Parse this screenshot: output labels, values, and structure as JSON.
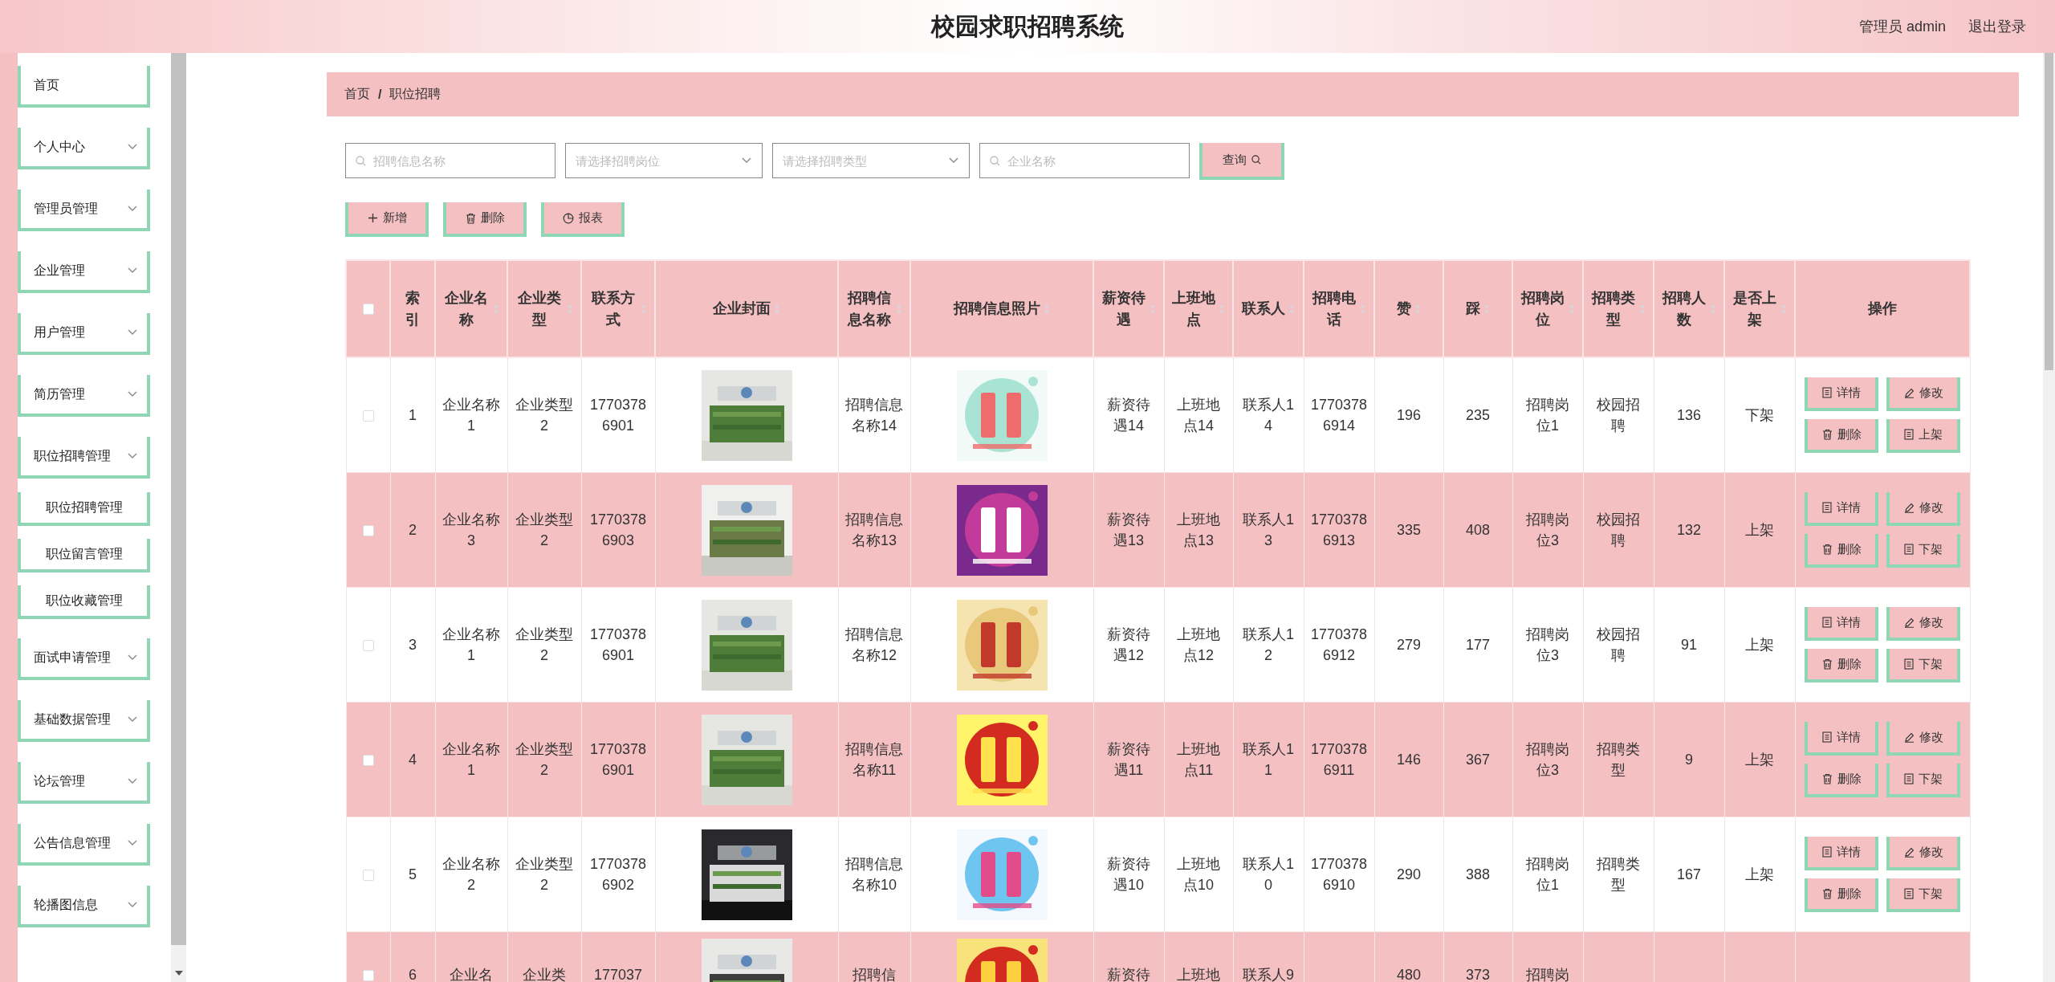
{
  "header": {
    "title": "校园求职招聘系统",
    "user": "管理员 admin",
    "logout": "退出登录"
  },
  "sidebar": {
    "items": [
      {
        "label": "首页",
        "kind": "link"
      },
      {
        "label": "个人中心",
        "kind": "menu"
      },
      {
        "label": "管理员管理",
        "kind": "menu"
      },
      {
        "label": "企业管理",
        "kind": "menu"
      },
      {
        "label": "用户管理",
        "kind": "menu"
      },
      {
        "label": "简历管理",
        "kind": "menu"
      },
      {
        "label": "职位招聘管理",
        "kind": "menu",
        "children": [
          {
            "label": "职位招聘管理"
          },
          {
            "label": "职位留言管理"
          },
          {
            "label": "职位收藏管理"
          }
        ]
      },
      {
        "label": "面试申请管理",
        "kind": "menu"
      },
      {
        "label": "基础数据管理",
        "kind": "menu"
      },
      {
        "label": "论坛管理",
        "kind": "menu"
      },
      {
        "label": "公告信息管理",
        "kind": "menu"
      },
      {
        "label": "轮播图信息",
        "kind": "menu"
      }
    ]
  },
  "breadcrumb": {
    "items": [
      "首页",
      "职位招聘"
    ],
    "separator": "/"
  },
  "search": {
    "fields": [
      {
        "kind": "text",
        "placeholder": "招聘信息名称"
      },
      {
        "kind": "select",
        "placeholder": "请选择招聘岗位"
      },
      {
        "kind": "select",
        "placeholder": "请选择招聘类型"
      },
      {
        "kind": "text",
        "placeholder": "企业名称"
      }
    ],
    "button": "查询"
  },
  "toolbar": [
    {
      "kind": "add",
      "label": "新增"
    },
    {
      "kind": "delete",
      "label": "删除"
    },
    {
      "kind": "report",
      "label": "报表"
    }
  ],
  "table": {
    "columns": [
      {
        "kind": "check",
        "checked": false
      },
      {
        "kind": "text",
        "label": "索引",
        "sortable": false
      },
      {
        "kind": "text",
        "label": "企业名称",
        "sortable": true
      },
      {
        "kind": "text",
        "label": "企业类型",
        "sortable": true
      },
      {
        "kind": "text",
        "label": "联系方式",
        "sortable": true
      },
      {
        "kind": "picture",
        "label": "企业封面",
        "sortable": true
      },
      {
        "kind": "text",
        "label": "招聘信息名称",
        "sortable": true
      },
      {
        "kind": "picture",
        "label": "招聘信息照片",
        "sortable": true
      },
      {
        "kind": "text",
        "label": "薪资待遇",
        "sortable": true
      },
      {
        "kind": "text",
        "label": "上班地点",
        "sortable": true
      },
      {
        "kind": "text",
        "label": "联系人",
        "sortable": true
      },
      {
        "kind": "text",
        "label": "招聘电话",
        "sortable": true
      },
      {
        "kind": "text",
        "label": "赞",
        "sortable": true
      },
      {
        "kind": "text",
        "label": "踩",
        "sortable": true
      },
      {
        "kind": "text",
        "label": "招聘岗位",
        "sortable": true
      },
      {
        "kind": "text",
        "label": "招聘类型",
        "sortable": true
      },
      {
        "kind": "text",
        "label": "招聘人数",
        "sortable": true
      },
      {
        "kind": "text",
        "label": "是否上架",
        "sortable": true
      },
      {
        "kind": "actions",
        "label": "操作",
        "sortable": false
      }
    ],
    "rows": [
      {
        "cells": [
          {
            "kind": "check",
            "checked": false
          },
          "1",
          "企业名称1",
          "企业类型2",
          "17703786901",
          {
            "kind": "picture"
          },
          "招聘信息名称14",
          {
            "kind": "picture"
          },
          "薪资待遇14",
          "上班地点14",
          "联系人14",
          "17703786914",
          "196",
          "235",
          "招聘岗位1",
          "校园招聘",
          "136",
          "下架",
          [
            {
              "kind": "detail",
              "label": "详情"
            },
            {
              "kind": "edit",
              "label": "修改"
            },
            {
              "kind": "delete",
              "label": "删除"
            },
            {
              "kind": "shelf",
              "label": "上架"
            }
          ]
        ]
      },
      {
        "cells": [
          {
            "kind": "check",
            "checked": false
          },
          "2",
          "企业名称3",
          "企业类型2",
          "17703786903",
          {
            "kind": "picture"
          },
          "招聘信息名称13",
          {
            "kind": "picture"
          },
          "薪资待遇13",
          "上班地点13",
          "联系人13",
          "17703786913",
          "335",
          "408",
          "招聘岗位3",
          "校园招聘",
          "132",
          "上架",
          [
            {
              "kind": "detail",
              "label": "详情"
            },
            {
              "kind": "edit",
              "label": "修改"
            },
            {
              "kind": "delete",
              "label": "删除"
            },
            {
              "kind": "shelf",
              "label": "下架"
            }
          ]
        ]
      },
      {
        "cells": [
          {
            "kind": "check",
            "checked": false
          },
          "3",
          "企业名称1",
          "企业类型2",
          "17703786901",
          {
            "kind": "picture"
          },
          "招聘信息名称12",
          {
            "kind": "picture"
          },
          "薪资待遇12",
          "上班地点12",
          "联系人12",
          "17703786912",
          "279",
          "177",
          "招聘岗位3",
          "校园招聘",
          "91",
          "上架",
          [
            {
              "kind": "detail",
              "label": "详情"
            },
            {
              "kind": "edit",
              "label": "修改"
            },
            {
              "kind": "delete",
              "label": "删除"
            },
            {
              "kind": "shelf",
              "label": "下架"
            }
          ]
        ]
      },
      {
        "cells": [
          {
            "kind": "check",
            "checked": false
          },
          "4",
          "企业名称1",
          "企业类型2",
          "17703786901",
          {
            "kind": "picture"
          },
          "招聘信息名称11",
          {
            "kind": "picture"
          },
          "薪资待遇11",
          "上班地点11",
          "联系人11",
          "17703786911",
          "146",
          "367",
          "招聘岗位3",
          "招聘类型",
          "9",
          "上架",
          [
            {
              "kind": "detail",
              "label": "详情"
            },
            {
              "kind": "edit",
              "label": "修改"
            },
            {
              "kind": "delete",
              "label": "删除"
            },
            {
              "kind": "shelf",
              "label": "下架"
            }
          ]
        ]
      },
      {
        "cells": [
          {
            "kind": "check",
            "checked": false
          },
          "5",
          "企业名称2",
          "企业类型2",
          "17703786902",
          {
            "kind": "picture"
          },
          "招聘信息名称10",
          {
            "kind": "picture"
          },
          "薪资待遇10",
          "上班地点10",
          "联系人10",
          "17703786910",
          "290",
          "388",
          "招聘岗位1",
          "招聘类型",
          "167",
          "上架",
          [
            {
              "kind": "detail",
              "label": "详情"
            },
            {
              "kind": "edit",
              "label": "修改"
            },
            {
              "kind": "delete",
              "label": "删除"
            },
            {
              "kind": "shelf",
              "label": "下架"
            }
          ]
        ]
      },
      {
        "cells": [
          {
            "kind": "check",
            "checked": false
          },
          "6",
          "企业名",
          "企业类",
          "177037",
          {
            "kind": "picture"
          },
          "招聘信",
          {
            "kind": "picture"
          },
          "薪资待",
          "上班地",
          "联系人9",
          "",
          "480",
          "373",
          "招聘岗"
        ]
      }
    ]
  }
}
